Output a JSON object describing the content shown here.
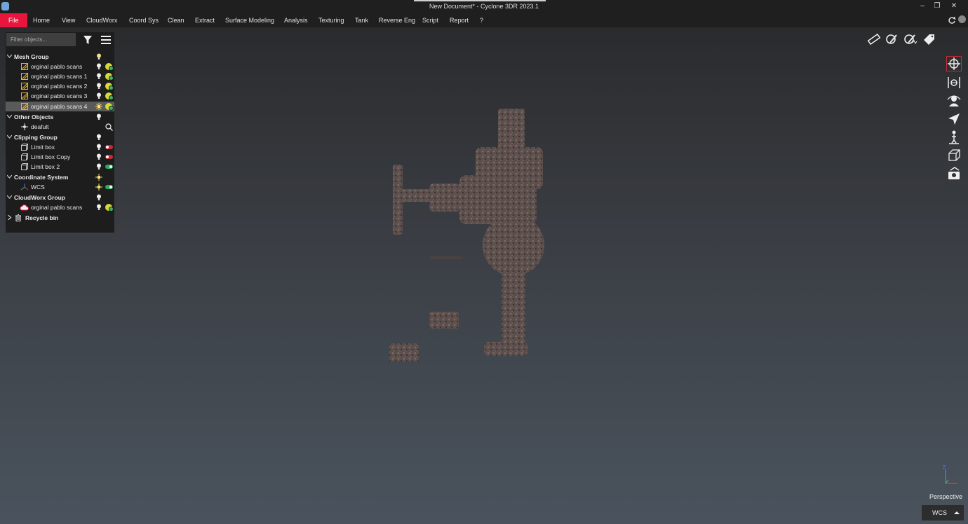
{
  "window": {
    "title": "New Document* - Cyclone 3DR 2023.1",
    "minimize_glyph": "–",
    "restore_glyph": "❐",
    "close_glyph": "✕"
  },
  "menu": {
    "items": [
      "File",
      "Home",
      "View",
      "CloudWorx",
      "Coord Sys",
      "Clean",
      "Extract",
      "Surface Modeling",
      "Analysis",
      "Texturing",
      "Tank",
      "Reverse Eng",
      "Script",
      "Report",
      "?"
    ],
    "active_color": "#e8163d"
  },
  "tree": {
    "filter_placeholder": "Filter objects...",
    "mesh_group": {
      "label": "Mesh Group",
      "items": [
        "orginal pablo scans",
        "orginal pablo scans 1",
        "orginal pablo scans 2",
        "orginal pablo scans 3",
        "orginal pablo scans 4"
      ],
      "selected_index": 4
    },
    "other_objects": {
      "label": "Other Objects",
      "items": [
        "deafult"
      ]
    },
    "clipping_group": {
      "label": "Clipping Group",
      "items": [
        "Limit box",
        "Limit box Copy",
        "Limit box 2"
      ]
    },
    "coordinate_system": {
      "label": "Coordinate System",
      "items": [
        "WCS"
      ]
    },
    "cloudworx_group": {
      "label": "CloudWorx Group",
      "items": [
        "orginal pablo scans"
      ]
    },
    "recycle_bin": {
      "label": "Recycle bin"
    }
  },
  "viewport": {
    "projection_label": "Perspective",
    "coord_system_value": "WCS",
    "triad_labels": {
      "z": "Z",
      "x": "X",
      "y": "Y"
    },
    "highlight_color": "#c62a36"
  },
  "toolbars": {
    "top_right": [
      "measure-icon",
      "inspect-pen-icon",
      "inspect-pen-graph-icon",
      "tag-icon"
    ],
    "side": [
      "orbit-icon",
      "pan-icon",
      "first-person-icon",
      "fly-icon",
      "walk-icon",
      "view-cube-icon",
      "camera-flip-icon"
    ]
  }
}
